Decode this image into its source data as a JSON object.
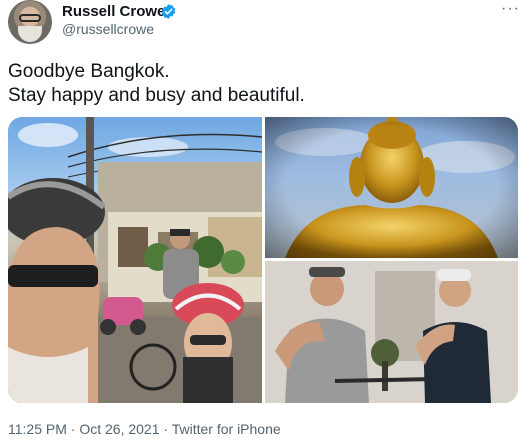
{
  "author": {
    "name": "Russell Crowe",
    "handle": "@russellcrowe",
    "verified": true
  },
  "more_icon": "more-horizontal-icon",
  "tweet": {
    "lines": [
      "Goodbye Bangkok.",
      "Stay happy and busy and beautiful."
    ]
  },
  "media": {
    "count": 3,
    "photos": [
      {
        "label": "Selfie with helmet on street"
      },
      {
        "label": "Golden Buddha statue"
      },
      {
        "label": "Two men with bicycle"
      }
    ]
  },
  "footer": {
    "time": "11:25 PM",
    "separator": " · ",
    "date": "Oct 26, 2021",
    "source": "Twitter for iPhone"
  },
  "colors": {
    "text": "#0f1419",
    "secondary": "#536471",
    "verified": "#1d9bf0"
  }
}
